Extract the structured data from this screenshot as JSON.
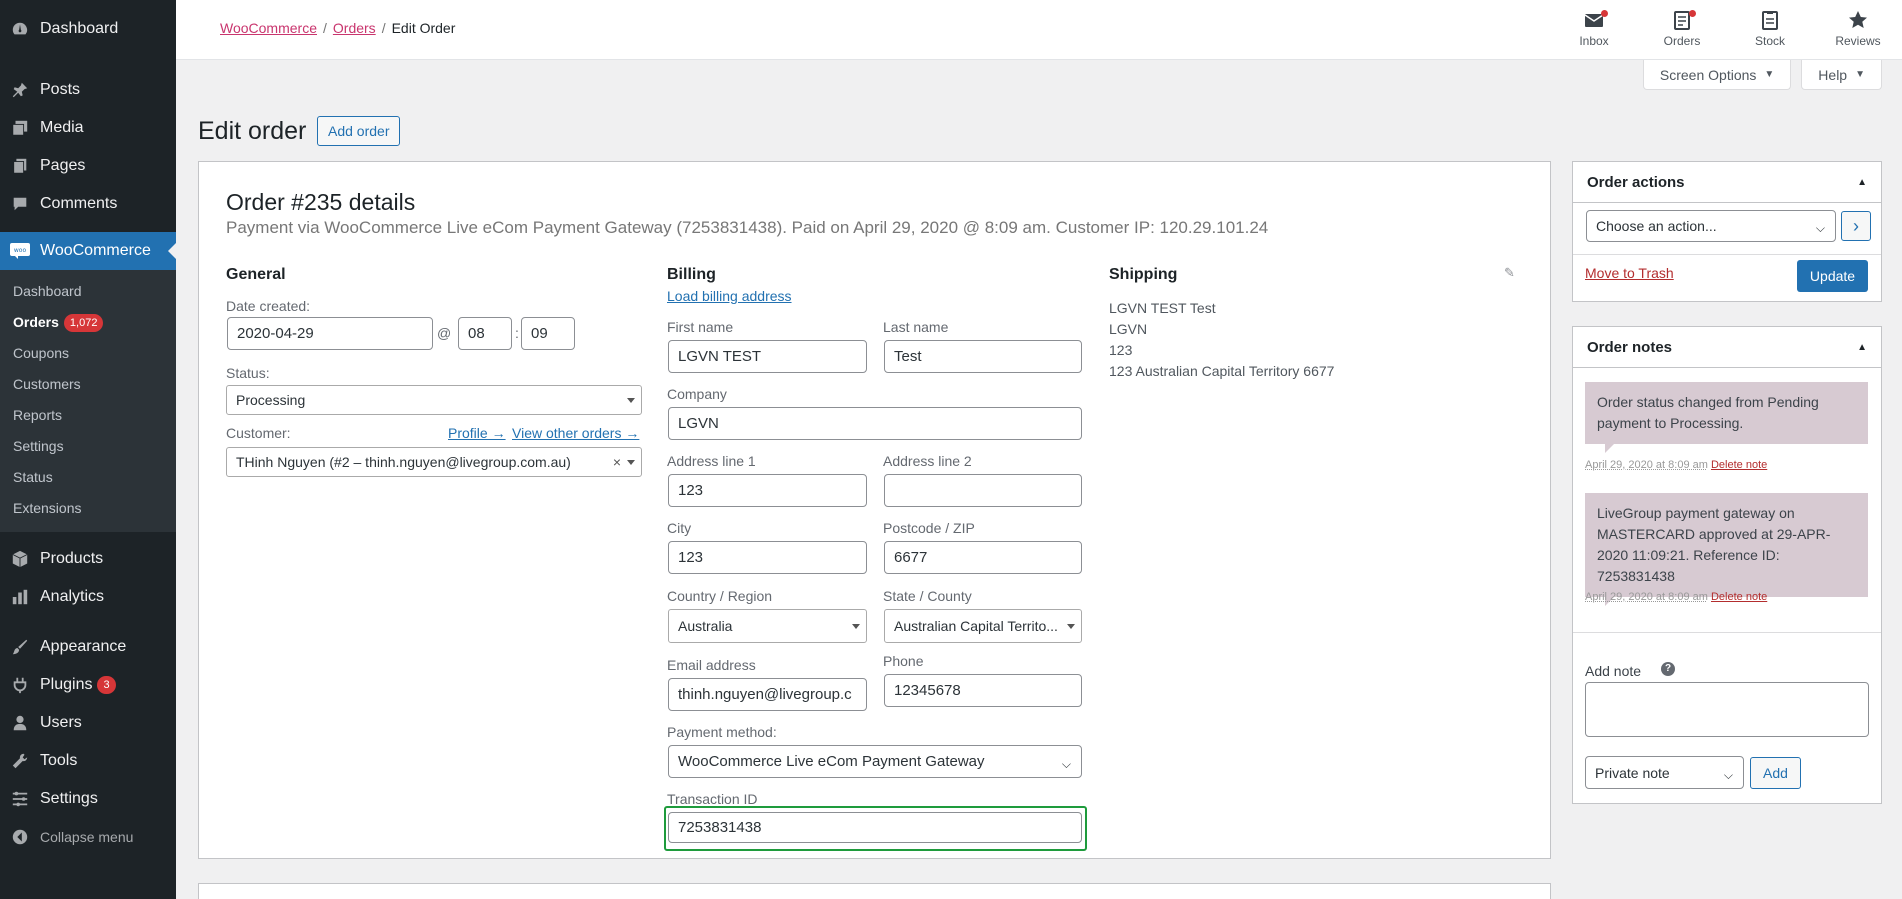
{
  "sidebar": {
    "dashboard": "Dashboard",
    "posts": "Posts",
    "media": "Media",
    "pages": "Pages",
    "comments": "Comments",
    "woocommerce": "WooCommerce",
    "woo_submenu": {
      "dashboard": "Dashboard",
      "orders": "Orders",
      "orders_count": "1,072",
      "coupons": "Coupons",
      "customers": "Customers",
      "reports": "Reports",
      "settings": "Settings",
      "status": "Status",
      "extensions": "Extensions"
    },
    "products": "Products",
    "analytics": "Analytics",
    "appearance": "Appearance",
    "plugins": "Plugins",
    "plugins_count": "3",
    "users": "Users",
    "tools": "Tools",
    "settings": "Settings",
    "collapse": "Collapse menu"
  },
  "header": {
    "breadcrumb": [
      "WooCommerce",
      "Orders",
      "Edit Order"
    ],
    "icons": {
      "inbox": "Inbox",
      "orders": "Orders",
      "stock": "Stock",
      "reviews": "Reviews"
    },
    "screen_options": "Screen Options",
    "help": "Help"
  },
  "page": {
    "title": "Edit order",
    "add_order": "Add order"
  },
  "order": {
    "heading": "Order #235 details",
    "meta": "Payment via WooCommerce Live eCom Payment Gateway (7253831438). Paid on April 29, 2020 @ 8:09 am. Customer IP: 120.29.101.24",
    "general": {
      "heading": "General",
      "date_label": "Date created:",
      "date": "2020-04-29",
      "at": "@",
      "hour": "08",
      "colon": ":",
      "minute": "09",
      "status_label": "Status:",
      "status": "Processing",
      "customer_label": "Customer:",
      "profile_link": "Profile →",
      "other_orders_link": "View other orders →",
      "customer": "THinh Nguyen (#2 – thinh.nguyen@livegroup.com.au)",
      "clear": "×"
    },
    "billing": {
      "heading": "Billing",
      "load_link": "Load billing address",
      "first_name_label": "First name",
      "first_name": "LGVN TEST",
      "last_name_label": "Last name",
      "last_name": "Test",
      "company_label": "Company",
      "company": "LGVN",
      "address1_label": "Address line 1",
      "address1": "123",
      "address2_label": "Address line 2",
      "address2": "",
      "city_label": "City",
      "city": "123",
      "postcode_label": "Postcode / ZIP",
      "postcode": "6677",
      "country_label": "Country / Region",
      "country": "Australia",
      "state_label": "State / County",
      "state": "Australian Capital Territo...",
      "email_label": "Email address",
      "email": "thinh.nguyen@livegroup.c",
      "phone_label": "Phone",
      "phone": "12345678",
      "payment_label": "Payment method:",
      "payment": "WooCommerce Live eCom Payment Gateway",
      "transaction_label": "Transaction ID",
      "transaction": "7253831438"
    },
    "shipping": {
      "heading": "Shipping",
      "lines": [
        "LGVN TEST Test",
        "LGVN",
        "123",
        "123 Australian Capital Territory 6677"
      ]
    }
  },
  "actions": {
    "heading": "Order actions",
    "select": "Choose an action...",
    "go": "›",
    "trash": "Move to Trash",
    "update": "Update"
  },
  "notes": {
    "heading": "Order notes",
    "items": [
      {
        "text": "Order status changed from Pending payment to Processing.",
        "date": "April 29, 2020 at 8:09 am",
        "delete": "Delete note"
      },
      {
        "text": "LiveGroup payment gateway on MASTERCARD approved at 29-APR-2020 11:09:21. Reference ID: 7253831438",
        "date": "April 29, 2020 at 8:09 am",
        "delete": "Delete note"
      }
    ],
    "add_label": "Add note",
    "help": "?",
    "type": "Private note",
    "add_button": "Add"
  }
}
